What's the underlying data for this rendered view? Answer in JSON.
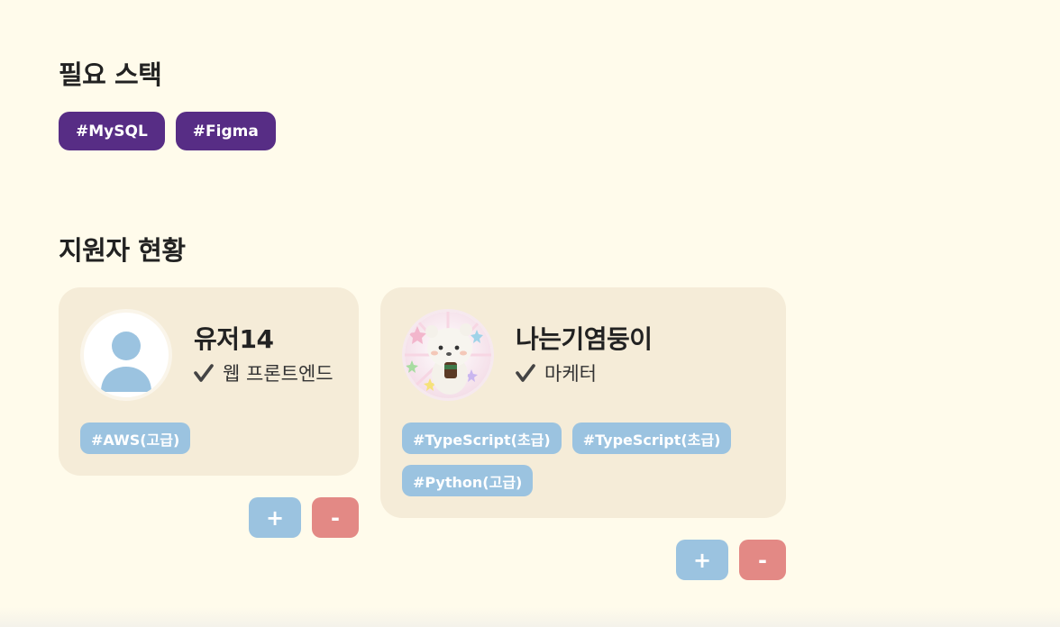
{
  "required_stack": {
    "title": "필요 스택",
    "tags": [
      "#MySQL",
      "#Figma"
    ]
  },
  "applicants": {
    "title": "지원자 현황",
    "items": [
      {
        "name": "유저14",
        "role": "웹 프론트엔드",
        "avatar_icon": "default-user-icon",
        "skills": [
          "#AWS(고급)"
        ],
        "plus_label": "+",
        "minus_label": "-"
      },
      {
        "name": "나는기염둥이",
        "role": "마케터",
        "avatar_icon": "bear-character-photo",
        "skills": [
          "#TypeScript(초급)",
          "#TypeScript(초급)",
          "#Python(고급)"
        ],
        "plus_label": "+",
        "minus_label": "-"
      }
    ]
  },
  "colors": {
    "background": "#fffbeb",
    "stack_tag": "#572d85",
    "card": "#f5ecd8",
    "skill_tag": "#9bc3e0",
    "plus_button": "#9bc3e0",
    "minus_button": "#e38985"
  }
}
